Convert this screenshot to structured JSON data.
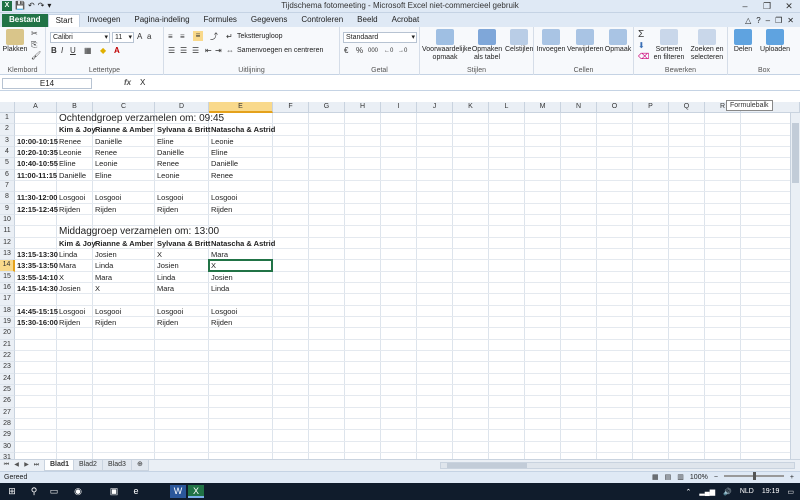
{
  "window": {
    "title": "Tijdschema fotomeeting - Microsoft Excel niet-commercieel gebruik",
    "app_icon": "X",
    "controls": [
      "–",
      "❐",
      "✕"
    ]
  },
  "tabs": {
    "file": "Bestand",
    "items": [
      "Start",
      "Invoegen",
      "Pagina-indeling",
      "Formules",
      "Gegevens",
      "Controleren",
      "Beeld",
      "Acrobat"
    ],
    "active": "Start",
    "right_icons": [
      "△",
      "?",
      "–",
      "❐",
      "✕"
    ]
  },
  "ribbon": {
    "clipboard": {
      "paste": "Plakken",
      "label": "Klembord"
    },
    "font": {
      "name": "Calibri",
      "size": "11",
      "label": "Lettertype",
      "bold": "B",
      "italic": "I",
      "underline": "U"
    },
    "alignment": {
      "wrap": "Tekstterugloop",
      "merge": "Samenvoegen en centreren",
      "label": "Uitlijning"
    },
    "number": {
      "format": "Standaard",
      "label": "Getal",
      "percent": "%",
      "thousands": "000"
    },
    "styles": {
      "conditional": "Voorwaardelijke opmaak",
      "table": "Opmaken als tabel",
      "cellstyles": "Celstijlen",
      "label": "Stijlen"
    },
    "cells": {
      "insert": "Invoegen",
      "delete": "Verwijderen",
      "format": "Opmaak",
      "label": "Cellen"
    },
    "editing": {
      "sum": "Σ",
      "sort": "Sorteren en filteren",
      "find": "Zoeken en selecteren",
      "label": "Bewerken"
    },
    "box": {
      "share": "Delen",
      "upload": "Uploaden",
      "label": "Box"
    }
  },
  "formula_bar": {
    "name_box": "E14",
    "fx": "fx",
    "content": "X",
    "tooltip": "Formulebalk"
  },
  "columns": [
    "A",
    "B",
    "C",
    "D",
    "E",
    "F",
    "G",
    "H",
    "I",
    "J",
    "K",
    "L",
    "M",
    "N",
    "O",
    "P",
    "Q",
    "R"
  ],
  "selected_column": "E",
  "selected_row": 14,
  "row_count": 31,
  "cells": {
    "B1": "Ochtendgroep verzamelen om: 09:45",
    "B2": "Kim & Joy",
    "C2": "Rianne & Amber",
    "D2": "Sylvana & Britt",
    "E2": "Natascha & Astrid",
    "A3": "10:00-10:15",
    "B3": "Renee",
    "C3": "Daniëlle",
    "D3": "Eline",
    "E3": "Leonie",
    "A4": "10:20-10:35",
    "B4": "Leonie",
    "C4": "Renee",
    "D4": "Daniëlle",
    "E4": "Eline",
    "A5": "10:40-10:55",
    "B5": "Eline",
    "C5": "Leonie",
    "D5": "Renee",
    "E5": "Daniëlle",
    "A6": "11:00-11:15",
    "B6": "Daniëlle",
    "C6": "Eline",
    "D6": "Leonie",
    "E6": "Renee",
    "A8": "11:30-12:00",
    "B8": "Losgooi",
    "C8": "Losgooi",
    "D8": "Losgooi",
    "E8": "Losgooi",
    "A9": "12:15-12:45",
    "B9": "Rijden",
    "C9": "Rijden",
    "D9": "Rijden",
    "E9": "Rijden",
    "B11": "Middaggroep verzamelen om: 13:00",
    "B12": "Kim & Joy",
    "C12": "Rianne & Amber",
    "D12": "Sylvana & Britt",
    "E12": "Natascha & Astrid",
    "A13": "13:15-13:30",
    "B13": "Linda",
    "C13": "Josien",
    "D13": "X",
    "E13": "Mara",
    "A14": "13:35-13:50",
    "B14": "Mara",
    "C14": "Linda",
    "D14": "Josien",
    "E14": "X",
    "A15": "13:55-14:10",
    "B15": "X",
    "C15": "Mara",
    "D15": "Linda",
    "E15": "Josien",
    "A16": "14:15-14:30",
    "B16": "Josien",
    "C16": "X",
    "D16": "Mara",
    "E16": "Linda",
    "A18": "14:45-15:15",
    "B18": "Losgooi",
    "C18": "Losgooi",
    "D18": "Losgooi",
    "E18": "Losgooi",
    "A19": "15:30-16:00",
    "B19": "Rijden",
    "C19": "Rijden",
    "D19": "Rijden",
    "E19": "Rijden"
  },
  "bold_cells": [
    "B2",
    "C2",
    "D2",
    "E2",
    "B12",
    "C12",
    "D12",
    "E12",
    "A3",
    "A4",
    "A5",
    "A6",
    "A8",
    "A9",
    "A13",
    "A14",
    "A15",
    "A16",
    "A18",
    "A19"
  ],
  "big_cells": [
    "B1",
    "B11"
  ],
  "sheets": [
    "Blad1",
    "Blad2",
    "Blad3"
  ],
  "active_sheet": "Blad1",
  "status": {
    "ready": "Gereed",
    "zoom": "100%"
  },
  "taskbar": {
    "items": [
      "⊞",
      "⚲",
      "▭",
      "◉",
      "▣",
      "e",
      "W",
      "X"
    ],
    "active": "X",
    "language": "NLD",
    "time": "19:19"
  },
  "accent_color": "#217346"
}
